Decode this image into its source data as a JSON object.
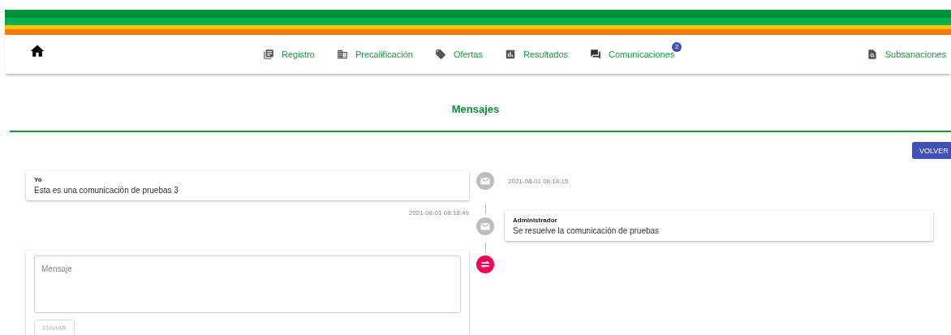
{
  "nav": {
    "items": [
      {
        "label": "Registro"
      },
      {
        "label": "Precalificación"
      },
      {
        "label": "Ofertas"
      },
      {
        "label": "Resultados"
      },
      {
        "label": "Comunicaciones",
        "badge": "2"
      }
    ],
    "right_item": {
      "label": "Subsanaciones"
    }
  },
  "title": "Mensajes",
  "back_button": "VOLVER",
  "timeline": [
    {
      "kind": "sent",
      "author": "Yo",
      "text": "Esta es una comunicación de pruebas 3",
      "date": "2021-08-01 08:18:15"
    },
    {
      "kind": "received",
      "author": "Administrador",
      "text": "Se resuelve la comunicación de pruebas",
      "date": "2021-08-01 08:18:49"
    },
    {
      "kind": "reply",
      "placeholder": "Mensaje",
      "button": "ENVIAR",
      "button_disabled": true
    }
  ]
}
